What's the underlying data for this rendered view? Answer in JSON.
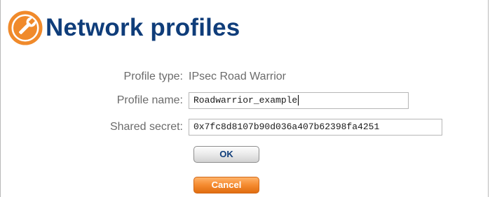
{
  "header": {
    "title": "Network profiles",
    "icon": "wrench-icon",
    "icon_color": "#f08a2b",
    "title_color": "#0f3d7a"
  },
  "form": {
    "profile_type_label": "Profile type:",
    "profile_type_value": "IPsec Road Warrior",
    "profile_name_label": "Profile name:",
    "profile_name_value": "Roadwarrior_example",
    "shared_secret_label": "Shared secret:",
    "shared_secret_value": "0x7fc8d8107b90d036a407b62398fa4251"
  },
  "buttons": {
    "ok_label": "OK",
    "cancel_label": "Cancel"
  }
}
